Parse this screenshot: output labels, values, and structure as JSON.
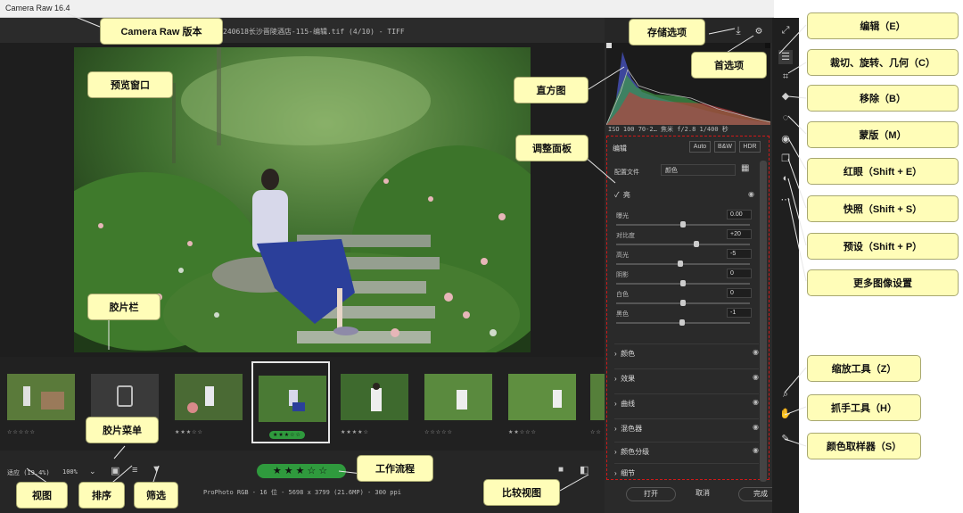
{
  "window": {
    "title": "Camera Raw 16.4"
  },
  "file": {
    "name": "240618长沙晋陵酒店-115-编辑.tif  (4/10)  -  TIFF"
  },
  "exif": {
    "text": "ISO 100    70-2…  焦米       f/2.8     1/400 秒"
  },
  "edit": {
    "title": "编辑",
    "modes": [
      "Auto",
      "B&W",
      "HDR"
    ],
    "profile_label": "配置文件",
    "profile_value": "颜色",
    "light_title": "亮",
    "sliders": [
      {
        "label": "曝光",
        "value": "0.00",
        "pos": 0.5
      },
      {
        "label": "对比度",
        "value": "+20",
        "pos": 0.6
      },
      {
        "label": "高光",
        "value": "-5",
        "pos": 0.48
      },
      {
        "label": "阴影",
        "value": "0",
        "pos": 0.5
      },
      {
        "label": "白色",
        "value": "0",
        "pos": 0.5
      },
      {
        "label": "黑色",
        "value": "-1",
        "pos": 0.49
      }
    ],
    "sections": [
      "颜色",
      "效果",
      "曲线",
      "混色器",
      "颜色分级",
      "细节"
    ]
  },
  "buttons": {
    "open": "打开",
    "cancel": "取消",
    "done": "完成"
  },
  "bottombar": {
    "fit": "适应 (19.4%)",
    "zoom": "100%",
    "workflow": "ProPhoto RGB - 16 位 - 5698 x 3799 (21.6MP) - 300 ppi",
    "rating_stars": "★★★☆☆"
  },
  "filmstrip": {
    "thumbs": [
      {
        "stars": "☆☆☆☆☆"
      },
      {
        "stars": "☆☆☆☆☆"
      },
      {
        "stars": "★★★☆☆"
      },
      {
        "stars": "★★★☆☆"
      },
      {
        "stars": "★★★★☆"
      },
      {
        "stars": "☆☆☆☆☆"
      },
      {
        "stars": "★★☆☆☆"
      },
      {
        "stars": "☆☆"
      }
    ]
  },
  "callouts": {
    "version": "Camera Raw 版本",
    "save_options": "存储选项",
    "preferences": "首选项",
    "preview": "预览窗口",
    "histogram": "直方图",
    "adjust_panel": "调整面板",
    "filmstrip": "胶片栏",
    "filmstrip_menu": "胶片菜单",
    "view": "视图",
    "sort": "排序",
    "filter": "筛选",
    "workflow": "工作流程",
    "compare": "比较视图",
    "edit": "编辑（E）",
    "crop": "裁切、旋转、几何（C）",
    "remove": "移除（B）",
    "mask": "蒙版（M）",
    "redeye": "红眼（Shift + E）",
    "snapshot": "快照（Shift + S）",
    "presets": "预设（Shift + P）",
    "more": "更多图像设置",
    "zoom_tool": "缩放工具（Z）",
    "hand_tool": "抓手工具（H）",
    "color_sampler": "颜色取样器（S）"
  },
  "colors": {
    "callout_bg": "#fffdb8",
    "adjust_border": "#d01818",
    "rating_green": "#2f9a3d"
  }
}
